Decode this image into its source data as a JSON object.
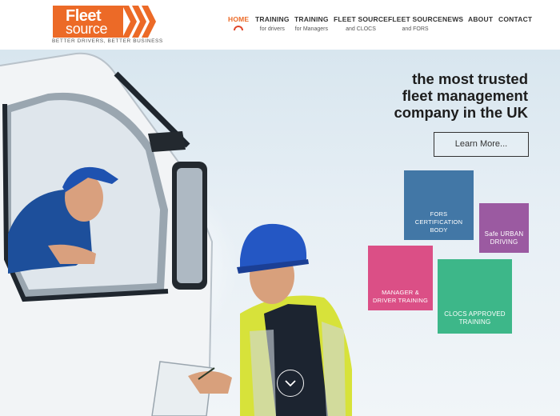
{
  "logo": {
    "word1": "Fleet",
    "word2": "source",
    "tagline": "BETTER DRIVERS, BETTER BUSINESS",
    "brand_color": "#ec6a27"
  },
  "nav": {
    "items": [
      {
        "label": "HOME",
        "sub": "",
        "active": true
      },
      {
        "label": "TRAINING",
        "sub": "for drivers"
      },
      {
        "label": "TRAINING",
        "sub": "for Managers"
      },
      {
        "label": "FLEET SOURCE",
        "sub": "and CLOCS"
      },
      {
        "label": "FLEET SOURCE",
        "sub": "and FORS"
      },
      {
        "label": "NEWS",
        "sub": ""
      },
      {
        "label": "ABOUT",
        "sub": ""
      },
      {
        "label": "CONTACT",
        "sub": ""
      }
    ],
    "active_color": "#ec6a27"
  },
  "hero": {
    "headline_lines": [
      "the most trusted",
      "fleet management",
      "company in the UK"
    ],
    "cta_label": "Learn More...",
    "tiles": [
      {
        "label": "FORS CERTIFICATION BODY",
        "color": "#4277a6"
      },
      {
        "label": "Safe URBAN DRIVING",
        "color": "#9b5aa1"
      },
      {
        "label": "MANAGER & DRIVER TRAINING",
        "color": "#db4f86"
      },
      {
        "label": "CLOCS APPROVED TRAINING",
        "color": "#3db789"
      }
    ],
    "scroll_icon": "chevron-down-icon"
  }
}
